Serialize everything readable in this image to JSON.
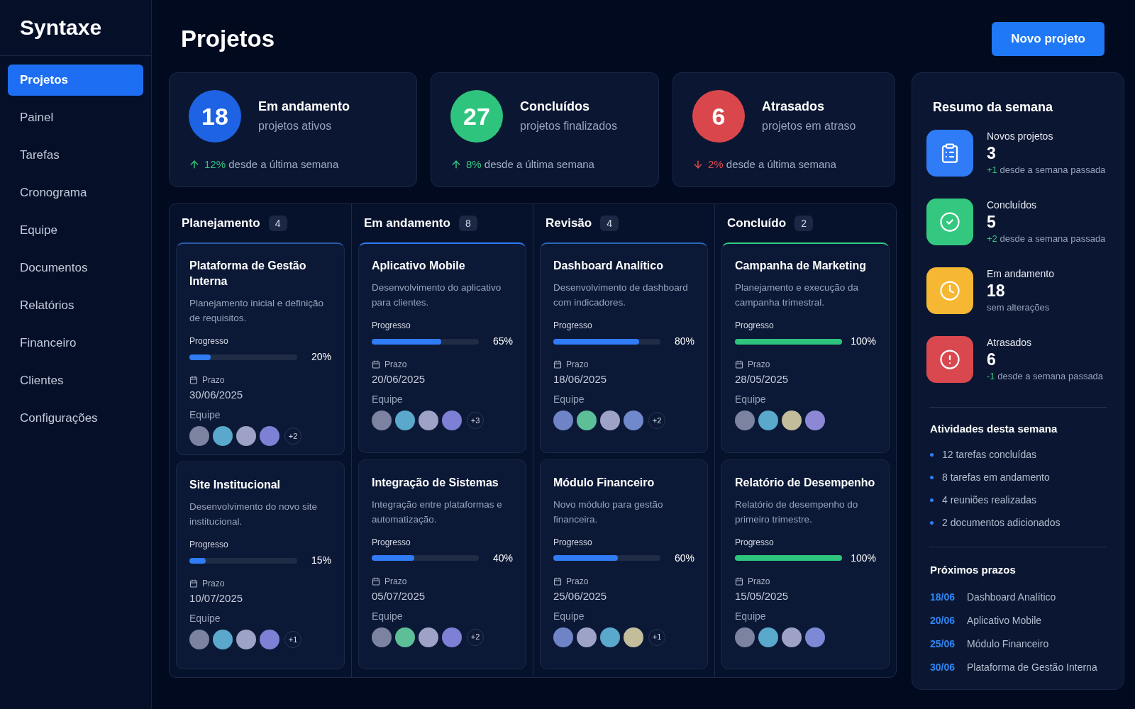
{
  "sidebar": {
    "logo": "Syntaxe",
    "items": [
      {
        "label": "Projetos",
        "selected": true
      },
      {
        "label": "Painel",
        "selected": false
      },
      {
        "label": "Tarefas",
        "selected": false
      },
      {
        "label": "Cronograma",
        "selected": false
      },
      {
        "label": "Equipe",
        "selected": false
      },
      {
        "label": "Documentos",
        "selected": false
      },
      {
        "label": "Relatórios",
        "selected": false
      },
      {
        "label": "Financeiro",
        "selected": false
      },
      {
        "label": "Clientes",
        "selected": false
      },
      {
        "label": "Configurações",
        "selected": false
      }
    ]
  },
  "header": {
    "title": "Projetos",
    "button": "Novo projeto"
  },
  "stats": [
    {
      "value": "18",
      "label": "Em andamento",
      "sub": "projetos ativos",
      "change": "12%",
      "note": "desde a última semana",
      "kind": "up",
      "color": "#1e63e3"
    },
    {
      "value": "27",
      "label": "Concluídos",
      "sub": "projetos finalizados",
      "change": "8%",
      "note": "desde a última semana",
      "kind": "up",
      "color": "#2fc47e"
    },
    {
      "value": "6",
      "label": "Atrasados",
      "sub": "projetos em atraso",
      "change": "2%",
      "note": "desde a última semana",
      "kind": "down",
      "color": "#d9474d"
    }
  ],
  "board": {
    "columns": [
      {
        "title": "Planejamento",
        "count": "4",
        "kind": "open",
        "color": "#2a5aa8",
        "cards": [
          {
            "highlighted": true,
            "title": "Plataforma de Gestão Interna",
            "description": "Planejamento inicial e definição de requisitos.",
            "progress_label": "Progresso",
            "level": 0.2,
            "percent": "20%",
            "deadline_label": "Prazo",
            "deadline": "30/06/2025",
            "team_label": "Equipe",
            "members": [
              {
                "color": "#7b83a0"
              },
              {
                "color": "#5aa8cb"
              },
              {
                "color": "#9ea2c6"
              },
              {
                "color": "#7d80d4"
              }
            ],
            "extra": "+2"
          },
          {
            "highlighted": false,
            "title": "Site Institucional",
            "description": "Desenvolvimento do novo site institucional.",
            "progress_label": "Progresso",
            "level": 0.15,
            "percent": "15%",
            "deadline_label": "Prazo",
            "deadline": "10/07/2025",
            "team_label": "Equipe",
            "members": [
              {
                "color": "#7b83a0"
              },
              {
                "color": "#5aa8cb"
              },
              {
                "color": "#9ea2c6"
              },
              {
                "color": "#7d80d4"
              }
            ],
            "extra": "+1"
          }
        ]
      },
      {
        "title": "Em andamento",
        "count": "8",
        "kind": "open",
        "color": "#2f7cf6",
        "cards": [
          {
            "highlighted": true,
            "title": "Aplicativo Mobile",
            "description": "Desenvolvimento do aplicativo para clientes.",
            "progress_label": "Progresso",
            "level": 0.65,
            "percent": "65%",
            "deadline_label": "Prazo",
            "deadline": "20/06/2025",
            "team_label": "Equipe",
            "members": [
              {
                "color": "#7b83a0"
              },
              {
                "color": "#5aa8cb"
              },
              {
                "color": "#9ea2c6"
              },
              {
                "color": "#7d80d4"
              }
            ],
            "extra": "+3"
          },
          {
            "highlighted": false,
            "title": "Integração de Sistemas",
            "description": "Integração entre plataformas e automatização.",
            "progress_label": "Progresso",
            "level": 0.4,
            "percent": "40%",
            "deadline_label": "Prazo",
            "deadline": "05/07/2025",
            "team_label": "Equipe",
            "members": [
              {
                "color": "#7b83a0"
              },
              {
                "color": "#5dbf97"
              },
              {
                "color": "#9ea2c6"
              },
              {
                "color": "#7d80d4"
              }
            ],
            "extra": "+2"
          }
        ]
      },
      {
        "title": "Revisão",
        "count": "4",
        "kind": "open",
        "color": "#2a68b8",
        "cards": [
          {
            "highlighted": true,
            "title": "Dashboard Analítico",
            "description": "Desenvolvimento de dashboard com indicadores.",
            "progress_label": "Progresso",
            "level": 0.8,
            "percent": "80%",
            "deadline_label": "Prazo",
            "deadline": "18/06/2025",
            "team_label": "Equipe",
            "members": [
              {
                "color": "#6f84c6"
              },
              {
                "color": "#5dbf97"
              },
              {
                "color": "#9ea2c6"
              },
              {
                "color": "#7088cc"
              }
            ],
            "extra": "+2"
          },
          {
            "highlighted": false,
            "title": "Módulo Financeiro",
            "description": "Novo módulo para gestão financeira.",
            "progress_label": "Progresso",
            "level": 0.6,
            "percent": "60%",
            "deadline_label": "Prazo",
            "deadline": "25/06/2025",
            "team_label": "Equipe",
            "members": [
              {
                "color": "#6f84c6"
              },
              {
                "color": "#9ea2c6"
              },
              {
                "color": "#5aa8cb"
              },
              {
                "color": "#c4bd9b"
              }
            ],
            "extra": "+1"
          }
        ]
      },
      {
        "title": "Concluído",
        "count": "2",
        "kind": "done",
        "color": "#2fcf83",
        "cards": [
          {
            "highlighted": true,
            "title": "Campanha de Marketing",
            "description": "Planejamento e execução da campanha trimestral.",
            "progress_label": "Progresso",
            "level": 1,
            "percent": "100%",
            "deadline_label": "Prazo",
            "deadline": "28/05/2025",
            "team_label": "Equipe",
            "members": [
              {
                "color": "#7b83a0"
              },
              {
                "color": "#5aa8cb"
              },
              {
                "color": "#c4bd9b"
              },
              {
                "color": "#8c88d6"
              }
            ]
          },
          {
            "highlighted": false,
            "title": "Relatório de Desempenho",
            "description": "Relatório de desempenho do primeiro trimestre.",
            "progress_label": "Progresso",
            "level": 1,
            "percent": "100%",
            "deadline_label": "Prazo",
            "deadline": "15/05/2025",
            "team_label": "Equipe",
            "members": [
              {
                "color": "#7b83a0"
              },
              {
                "color": "#5aa8cb"
              },
              {
                "color": "#9ea2c6"
              },
              {
                "color": "#7d88d6"
              }
            ]
          }
        ]
      }
    ]
  },
  "summary": {
    "title": "Resumo da semana",
    "items": [
      {
        "kind": "new",
        "color": "#2f7cf6",
        "label": "Novos projetos",
        "value": "3",
        "delta": "+1",
        "note": "desde a semana passada"
      },
      {
        "kind": "completed",
        "color": "#34c77f",
        "label": "Concluídos",
        "value": "5",
        "delta": "+2",
        "note": "desde a semana passada"
      },
      {
        "kind": "in_progress",
        "color": "#f6b732",
        "label": "Em andamento",
        "value": "18",
        "note": "sem alterações"
      },
      {
        "kind": "overdue",
        "color": "#d9484e",
        "label": "Atrasados",
        "value": "6",
        "delta": "-1",
        "note": "desde a semana passada"
      }
    ],
    "activities": {
      "title": "Atividades desta semana",
      "items": [
        "12 tarefas concluídas",
        "8 tarefas em andamento",
        "4 reuniões realizadas",
        "2 documentos adicionados"
      ]
    },
    "deadlines": {
      "title": "Próximos prazos",
      "items": [
        {
          "date": "18/06",
          "name": "Dashboard Analítico"
        },
        {
          "date": "20/06",
          "name": "Aplicativo Mobile"
        },
        {
          "date": "25/06",
          "name": "Módulo Financeiro"
        },
        {
          "date": "30/06",
          "name": "Plataforma de Gestão Interna"
        }
      ]
    }
  }
}
